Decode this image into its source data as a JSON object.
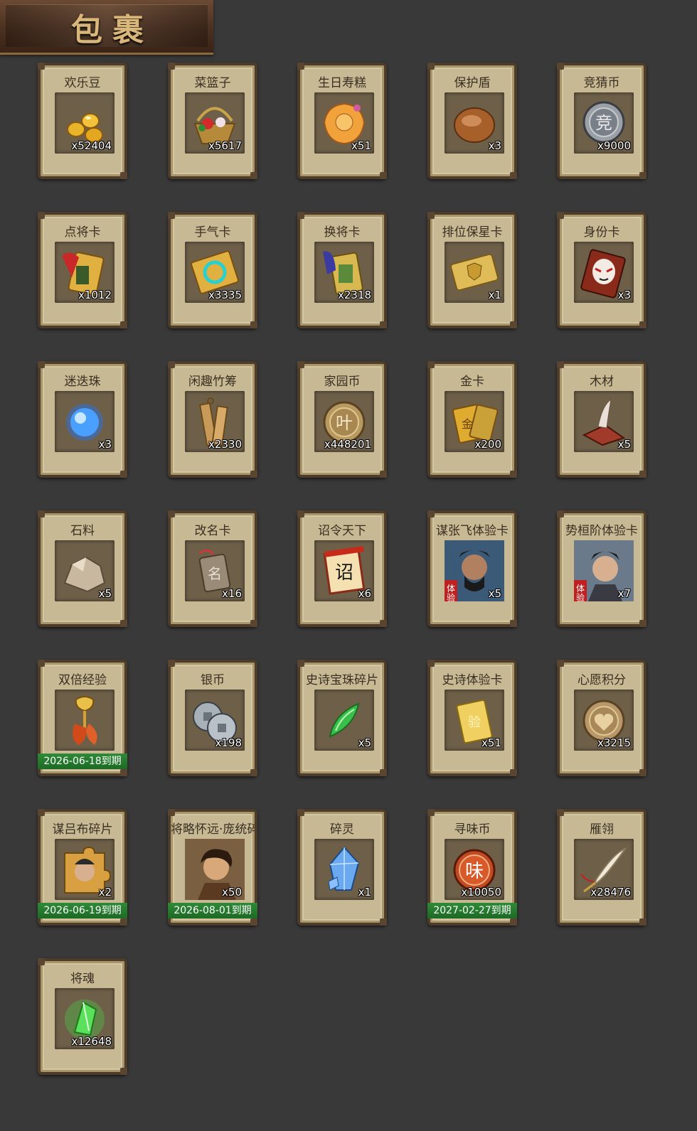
{
  "header": {
    "title": "包裹"
  },
  "items": [
    {
      "name": "欢乐豆",
      "count": "x52404",
      "icon": "golden-beans-icon"
    },
    {
      "name": "菜篮子",
      "count": "x5617",
      "icon": "flower-basket-icon"
    },
    {
      "name": "生日寿糕",
      "count": "x51",
      "icon": "birthday-cake-icon"
    },
    {
      "name": "保护盾",
      "count": "x3",
      "icon": "shield-icon"
    },
    {
      "name": "竞猜币",
      "count": "x9000",
      "icon": "guess-coin-icon"
    },
    {
      "name": "点将卡",
      "count": "x1012",
      "icon": "general-pick-card-icon"
    },
    {
      "name": "手气卡",
      "count": "x3335",
      "icon": "luck-card-icon"
    },
    {
      "name": "换将卡",
      "count": "x2318",
      "icon": "swap-general-card-icon"
    },
    {
      "name": "排位保星卡",
      "count": "x1",
      "icon": "rank-star-card-icon"
    },
    {
      "name": "身份卡",
      "count": "x3",
      "icon": "identity-card-icon"
    },
    {
      "name": "迷迭珠",
      "count": "x3",
      "icon": "blue-orb-icon"
    },
    {
      "name": "闲趣竹筹",
      "count": "x2330",
      "icon": "bamboo-token-icon"
    },
    {
      "name": "家园币",
      "count": "x448201",
      "icon": "home-coin-icon"
    },
    {
      "name": "金卡",
      "count": "x200",
      "icon": "gold-card-icon"
    },
    {
      "name": "木材",
      "count": "x5",
      "icon": "wood-icon"
    },
    {
      "name": "石料",
      "count": "x5",
      "icon": "stone-icon"
    },
    {
      "name": "改名卡",
      "count": "x16",
      "icon": "rename-card-icon"
    },
    {
      "name": "诏令天下",
      "count": "x6",
      "icon": "edict-scroll-icon"
    },
    {
      "name": "谋张飞体验卡",
      "count": "x5",
      "icon": "zhangfei-portrait-icon"
    },
    {
      "name": "势桓阶体验卡",
      "count": "x7",
      "icon": "huanjie-portrait-icon"
    },
    {
      "name": "双倍经验",
      "count": "",
      "icon": "double-exp-icon",
      "expiry": "2026-06-18到期"
    },
    {
      "name": "银币",
      "count": "x198",
      "icon": "silver-coin-icon"
    },
    {
      "name": "史诗宝珠碎片",
      "count": "x5",
      "icon": "green-shard-icon"
    },
    {
      "name": "史诗体验卡",
      "count": "x51",
      "icon": "epic-trial-card-icon"
    },
    {
      "name": "心愿积分",
      "count": "x3215",
      "icon": "wish-coin-icon"
    },
    {
      "name": "谋吕布碎片",
      "count": "x2",
      "icon": "lubu-puzzle-icon",
      "expiry": "2026-06-19到期"
    },
    {
      "name": "将略怀远·庞统碎片",
      "count": "x50",
      "icon": "pangtong-portrait-icon",
      "expiry": "2026-08-01到期"
    },
    {
      "name": "碎灵",
      "count": "x1",
      "icon": "blue-crystal-icon"
    },
    {
      "name": "寻味币",
      "count": "x10050",
      "icon": "flavor-coin-icon",
      "expiry": "2027-02-27到期"
    },
    {
      "name": "雁翎",
      "count": "x28476",
      "icon": "feather-icon"
    },
    {
      "name": "将魂",
      "count": "x12648",
      "icon": "green-soul-icon"
    }
  ]
}
